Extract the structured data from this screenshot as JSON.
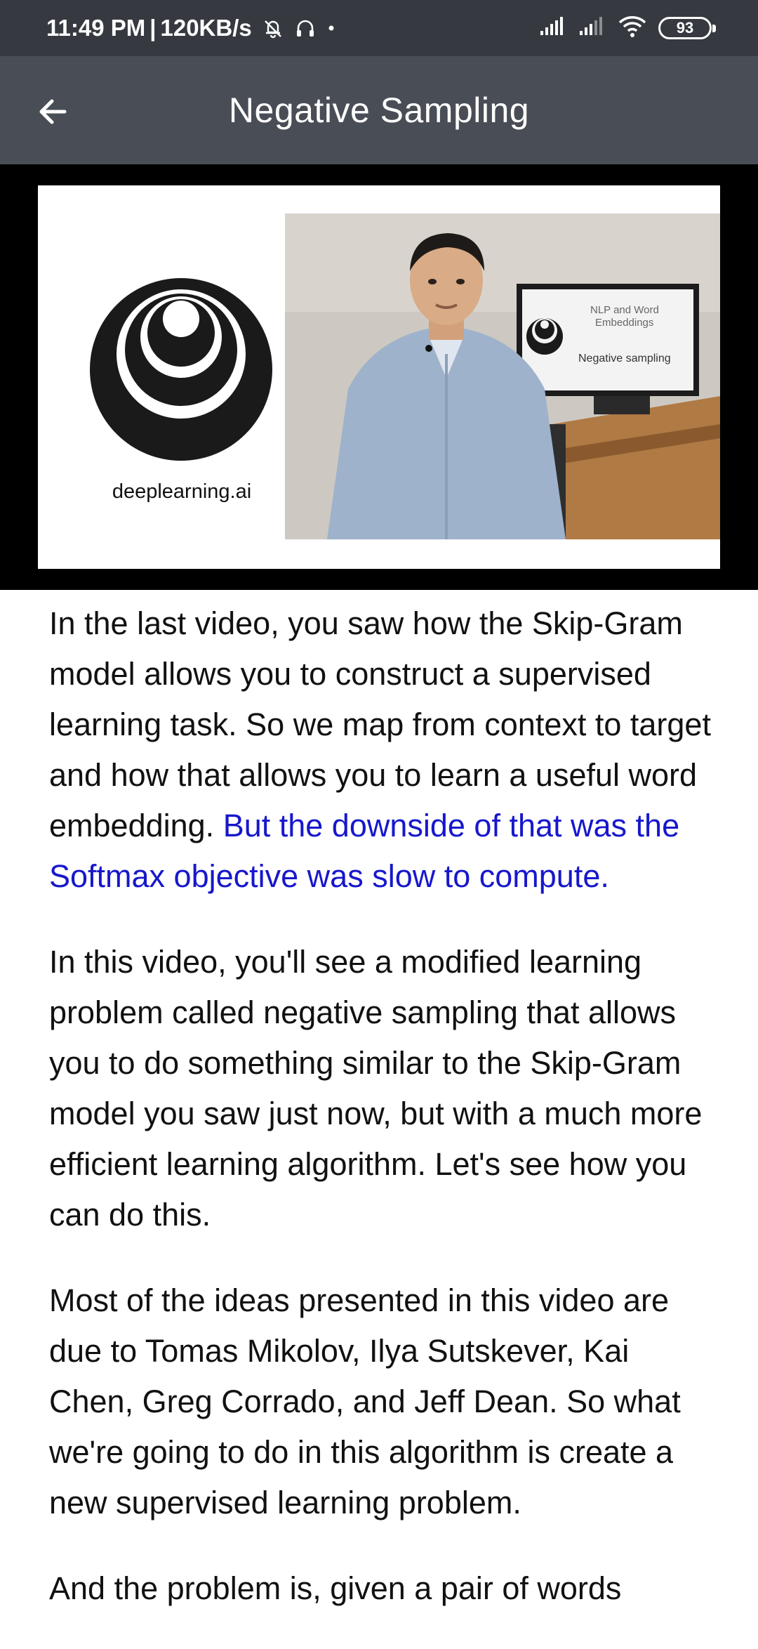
{
  "status_bar": {
    "time": "11:49 PM",
    "separator": "|",
    "speed": "120KB/s",
    "battery": "93",
    "icons": [
      "bell-muted-icon",
      "headphones-icon",
      "dot-icon",
      "cell-signal-icon",
      "cell-signal-2-icon",
      "wifi-icon",
      "battery-icon"
    ]
  },
  "app_bar": {
    "title": "Negative Sampling",
    "back_icon": "arrow-left-icon"
  },
  "video": {
    "logo_text": "deeplearning.ai",
    "screen_title": "NLP and Word",
    "screen_subtitle": "Embeddings",
    "screen_topic": "Negative sampling"
  },
  "transcript": {
    "p1_normal": "In the last video, you saw how the Skip-Gram model allows you to construct a supervised learning task. So we map from context to target and how that allows you to learn a useful word embedding. ",
    "p1_highlight": "But the downside of that was the Softmax objective was slow to compute.",
    "p2": "In this video, you'll see a modified learning problem called negative sampling that allows you to do something similar to the Skip-Gram model you saw just now, but with a much more efficient learning algorithm. Let's see how you can do this.",
    "p3": "Most of the ideas presented in this video are due to Tomas Mikolov, Ilya Sutskever, Kai Chen, Greg Corrado, and Jeff Dean. So what we're going to do in this algorithm is create a new supervised learning problem.",
    "p4": "And the problem is, given a pair of words"
  },
  "colors": {
    "status_bar_bg": "#363a40",
    "app_bar_bg": "#494e56",
    "highlight": "#1717cc",
    "text": "#111111"
  }
}
